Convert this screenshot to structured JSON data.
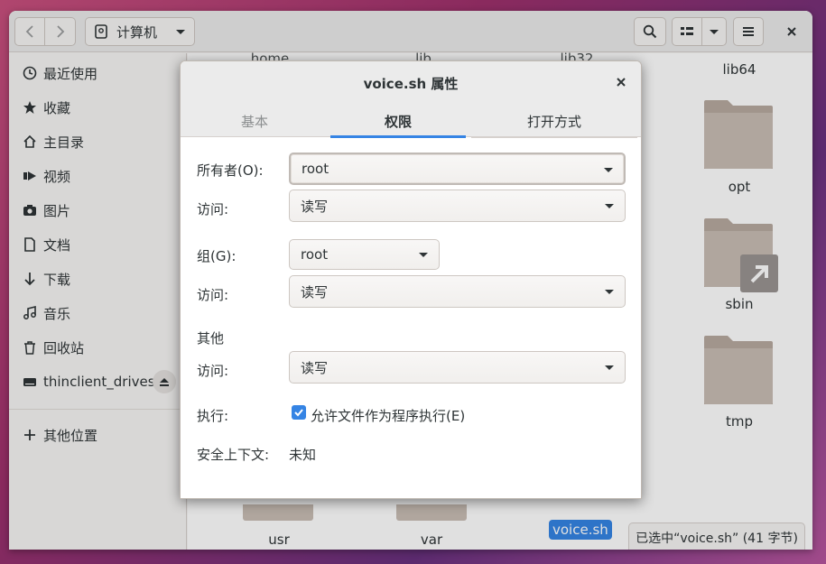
{
  "window": {
    "path_label": "计算机"
  },
  "sidebar": {
    "items": [
      {
        "label": "最近使用",
        "icon": "clock-icon"
      },
      {
        "label": "收藏",
        "icon": "star-icon"
      },
      {
        "label": "主目录",
        "icon": "home-icon"
      },
      {
        "label": "视频",
        "icon": "video-icon"
      },
      {
        "label": "图片",
        "icon": "camera-icon"
      },
      {
        "label": "文档",
        "icon": "document-icon"
      },
      {
        "label": "下载",
        "icon": "download-icon"
      },
      {
        "label": "音乐",
        "icon": "music-icon"
      },
      {
        "label": "回收站",
        "icon": "trash-icon"
      },
      {
        "label": "thinclient_drives",
        "icon": "drive-icon"
      },
      {
        "label": "其他位置",
        "icon": "plus-icon"
      }
    ]
  },
  "content": {
    "top_labels": [
      "home",
      "lib",
      "lib32",
      "lib64"
    ],
    "folders": [
      "opt",
      "sbin",
      "tmp"
    ],
    "bottom_labels": [
      "usr",
      "var",
      "voice.sh"
    ],
    "status": "已选中“voice.sh” (41 字节)"
  },
  "dialog": {
    "title": "voice.sh 属性",
    "tabs": [
      "基本",
      "权限",
      "打开方式"
    ],
    "active_tab": "权限",
    "owner_label": "所有者(O):",
    "owner_value": "root",
    "owner_access_label": "访问:",
    "owner_access_value": "读写",
    "group_label": "组(G):",
    "group_value": "root",
    "group_access_label": "访问:",
    "group_access_value": "读写",
    "others_heading": "其他",
    "others_access_label": "访问:",
    "others_access_value": "读写",
    "execute_label": "执行:",
    "execute_checkbox_label": "允许文件作为程序执行(E)",
    "execute_checked": true,
    "security_label": "安全上下文:",
    "security_value": "未知"
  },
  "colors": {
    "accent": "#3584e4",
    "folder": "#c9bdb4",
    "folder_top": "#b8aaa0"
  }
}
